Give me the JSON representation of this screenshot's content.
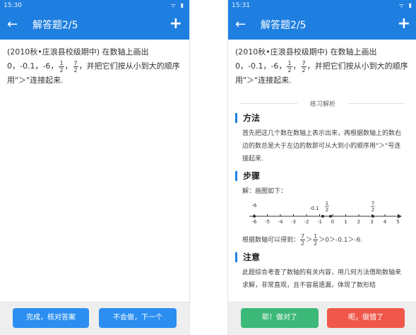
{
  "status": {
    "time_left": "15:30",
    "time_right": "15:31",
    "icons": "ᯤ ▮"
  },
  "appbar": {
    "title": "解答题2/5",
    "back_icon": "←",
    "plus_icon": "+"
  },
  "question": {
    "line1": "(2010秋•庄浪县校级期中) 在数轴上画出",
    "nums": "0，-0.1，-6，",
    "f1": {
      "num": "1",
      "den": "2"
    },
    "comma": "，",
    "f2": {
      "num": "7",
      "den": "2"
    },
    "rest": "，并把它们按从小到大的顺序",
    "line3": "用\"＞\"连接起来."
  },
  "analysis": {
    "label": "练习解析",
    "method_title": "方法",
    "method_text": "首先把这几个数在数轴上表示出来，再根据数轴上的数右边的数总是大于左边的数即可从大到小的顺序用\"＞\"号连接起来.",
    "steps_title": "步骤",
    "steps_intro": "解：画图如下：",
    "number_line": {
      "ticks": [
        "-6",
        "-5",
        "-4",
        "-3",
        "-2",
        "-1",
        "0",
        "1",
        "2",
        "3",
        "4",
        "5"
      ],
      "marked": {
        "m6": "-6",
        "m01": "-0.1",
        "f_half_num": "1",
        "f_half_den": "2",
        "f_72_num": "7",
        "f_72_den": "2"
      }
    },
    "steps_result_prefix": "根据数轴可以得到：",
    "steps_result_suffix": "＞0＞-0.1＞-6.",
    "res_f1": {
      "num": "7",
      "den": "2"
    },
    "res_gt": "＞",
    "res_f2": {
      "num": "1",
      "den": "2"
    },
    "note_title": "注意",
    "note_text": "此题综合考查了数轴的有关内容，用几何方法借助数轴来求解，非常直观，且不容易遗漏，体现了数形结"
  },
  "buttons": {
    "left_done": "完成，核对答案",
    "left_skip": "不会做，下一个",
    "right_correct": "耶！做对了",
    "right_wrong": "呃，做错了"
  }
}
